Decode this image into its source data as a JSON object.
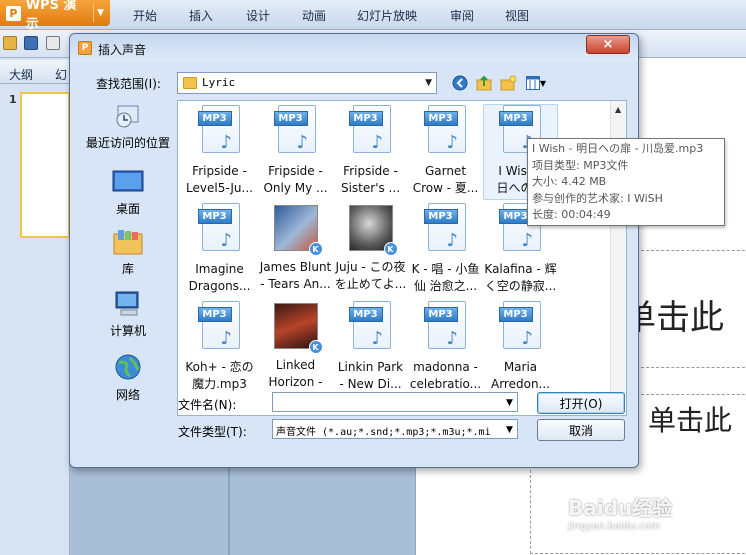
{
  "app": {
    "name": "WPS 演示",
    "menu": [
      "开始",
      "插入",
      "设计",
      "动画",
      "幻灯片放映",
      "审阅",
      "视图"
    ]
  },
  "left_panel": {
    "tabs": [
      "大纲",
      "幻"
    ],
    "slide_number": "1"
  },
  "slide": {
    "placeholder_title": "单击此",
    "placeholder_subtitle": "单击此"
  },
  "dialog": {
    "title": "插入声音",
    "close_label": "×",
    "look_in_label": "查找范围(I):",
    "look_in_value": "Lyric",
    "places": [
      {
        "label": "最近访问的位置",
        "icon": "recent-places-icon"
      },
      {
        "label": "桌面",
        "icon": "desktop-icon"
      },
      {
        "label": "库",
        "icon": "libraries-icon"
      },
      {
        "label": "计算机",
        "icon": "computer-icon"
      },
      {
        "label": "网络",
        "icon": "network-icon"
      }
    ],
    "files": [
      {
        "line1": "Fripside -",
        "line2": "Level5-Ju...",
        "type": "mp3"
      },
      {
        "line1": "Fripside -",
        "line2": "Only My ...",
        "type": "mp3"
      },
      {
        "line1": "Fripside -",
        "line2": "Sister's ...",
        "type": "mp3"
      },
      {
        "line1": "Garnet",
        "line2": "Crow - 夏...",
        "type": "mp3"
      },
      {
        "line1": "I Wish -",
        "line2": "日への扉",
        "type": "mp3"
      },
      {
        "line1": "Imagine",
        "line2": "Dragons...",
        "type": "mp3"
      },
      {
        "line1": "James Blunt",
        "line2": "- Tears An...",
        "type": "album"
      },
      {
        "line1": "Juju - この夜",
        "line2": "を止めてよ...",
        "type": "album"
      },
      {
        "line1": "K - 唱 - 小鱼",
        "line2": "仙 治愈之...",
        "type": "mp3"
      },
      {
        "line1": "Kalafina - 辉",
        "line2": "く空の静寂...",
        "type": "mp3"
      },
      {
        "line1": "Koh+ - 恋の",
        "line2": "魔力.mp3",
        "type": "mp3"
      },
      {
        "line1": "Linked",
        "line2": "Horizon -",
        "type": "album"
      },
      {
        "line1": "Linkin Park",
        "line2": "- New Di...",
        "type": "mp3"
      },
      {
        "line1": "madonna -",
        "line2": "celebratio...",
        "type": "mp3"
      },
      {
        "line1": "Maria",
        "line2": "Arredon...",
        "type": "mp3"
      }
    ],
    "mp3_tag": "MP3",
    "album_badge": "K",
    "tooltip": {
      "name": "I Wish - 明日への扉 - 川岛爱.mp3",
      "type": "项目类型: MP3文件",
      "size": "大小: 4.42 MB",
      "artist": "参与创作的艺术家: I WiSH",
      "length": "长度: 00:04:49"
    },
    "filename_label": "文件名(N):",
    "filename_value": "",
    "filetype_label": "文件类型(T):",
    "filetype_value": "声音文件 (*.au;*.snd;*.mp3;*.m3u;*.mi",
    "open_button": "打开(O)",
    "cancel_button": "取消"
  },
  "watermark": {
    "text": "Baidu经验",
    "url": "jingyan.baidu.com"
  }
}
